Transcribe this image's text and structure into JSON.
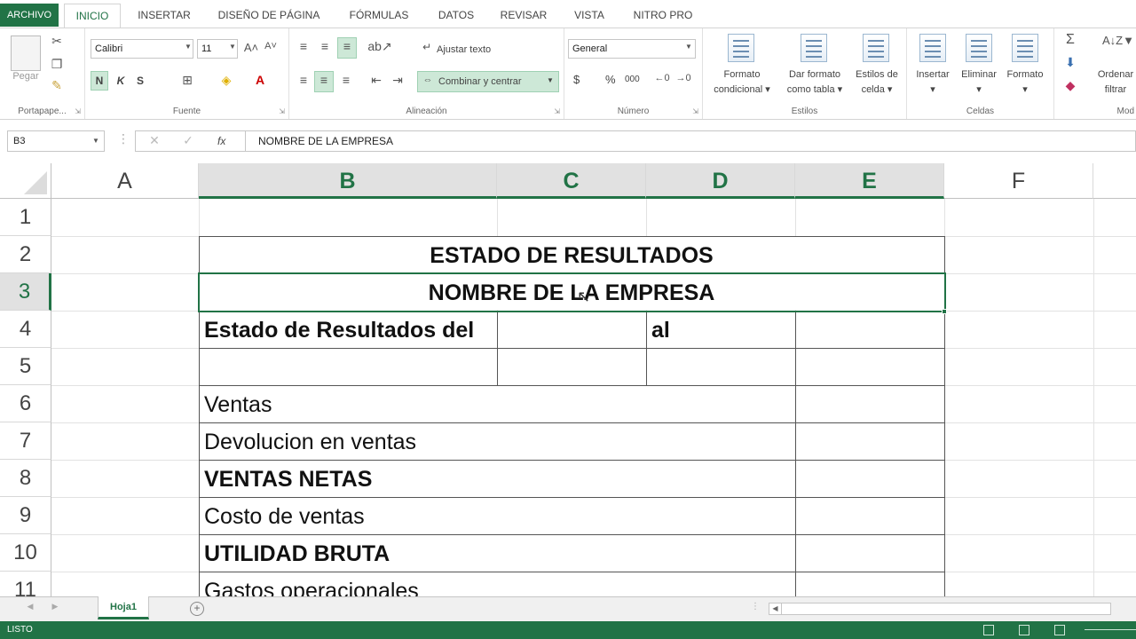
{
  "ribbon_tabs": {
    "file": "ARCHIVO",
    "items": [
      "INICIO",
      "INSERTAR",
      "DISEÑO DE PÁGINA",
      "FÓRMULAS",
      "DATOS",
      "REVISAR",
      "VISTA",
      "NITRO PRO"
    ],
    "active": "INICIO"
  },
  "clipboard": {
    "paste_label": "Pegar",
    "group_label": "Portapape..."
  },
  "font": {
    "name": "Calibri",
    "size": "11",
    "bold": "N",
    "italic": "K",
    "underline": "S",
    "group_label": "Fuente"
  },
  "alignment": {
    "wrap_text": "Ajustar texto",
    "merge_center": "Combinar y centrar",
    "group_label": "Alineación"
  },
  "number": {
    "format": "General",
    "currency": "$",
    "percent": "%",
    "thousands": "000",
    "group_label": "Número"
  },
  "styles": {
    "conditional_1": "Formato",
    "conditional_2": "condicional",
    "table_1": "Dar formato",
    "table_2": "como tabla",
    "cell_1": "Estilos de",
    "cell_2": "celda",
    "group_label": "Estilos"
  },
  "cells_group": {
    "insert": "Insertar",
    "delete": "Eliminar",
    "format": "Formato",
    "group_label": "Celdas"
  },
  "editing": {
    "sort_1": "Ordenar",
    "sort_2": "filtrar",
    "group_label": "Mod"
  },
  "formula_bar": {
    "name_box": "B3",
    "content": "NOMBRE DE LA EMPRESA",
    "fx": "fx"
  },
  "columns": [
    "A",
    "B",
    "C",
    "D",
    "E",
    "F"
  ],
  "rows": [
    "1",
    "2",
    "3",
    "4",
    "5",
    "6",
    "7",
    "8",
    "9",
    "10",
    "11"
  ],
  "cells": {
    "b2": "ESTADO DE RESULTADOS",
    "b3": "NOMBRE DE LA EMPRESA",
    "b4": "Estado de Resultados del",
    "d4": "al",
    "b6": "Ventas",
    "b7": "Devolucion en ventas",
    "b8": "VENTAS NETAS",
    "b9": "Costo de ventas",
    "b10": "UTILIDAD BRUTA",
    "b11": "Gastos operacionales"
  },
  "sheets": {
    "active": "Hoja1",
    "add": "+"
  },
  "status": {
    "text": "LISTO"
  },
  "colors": {
    "accent": "#217346"
  }
}
